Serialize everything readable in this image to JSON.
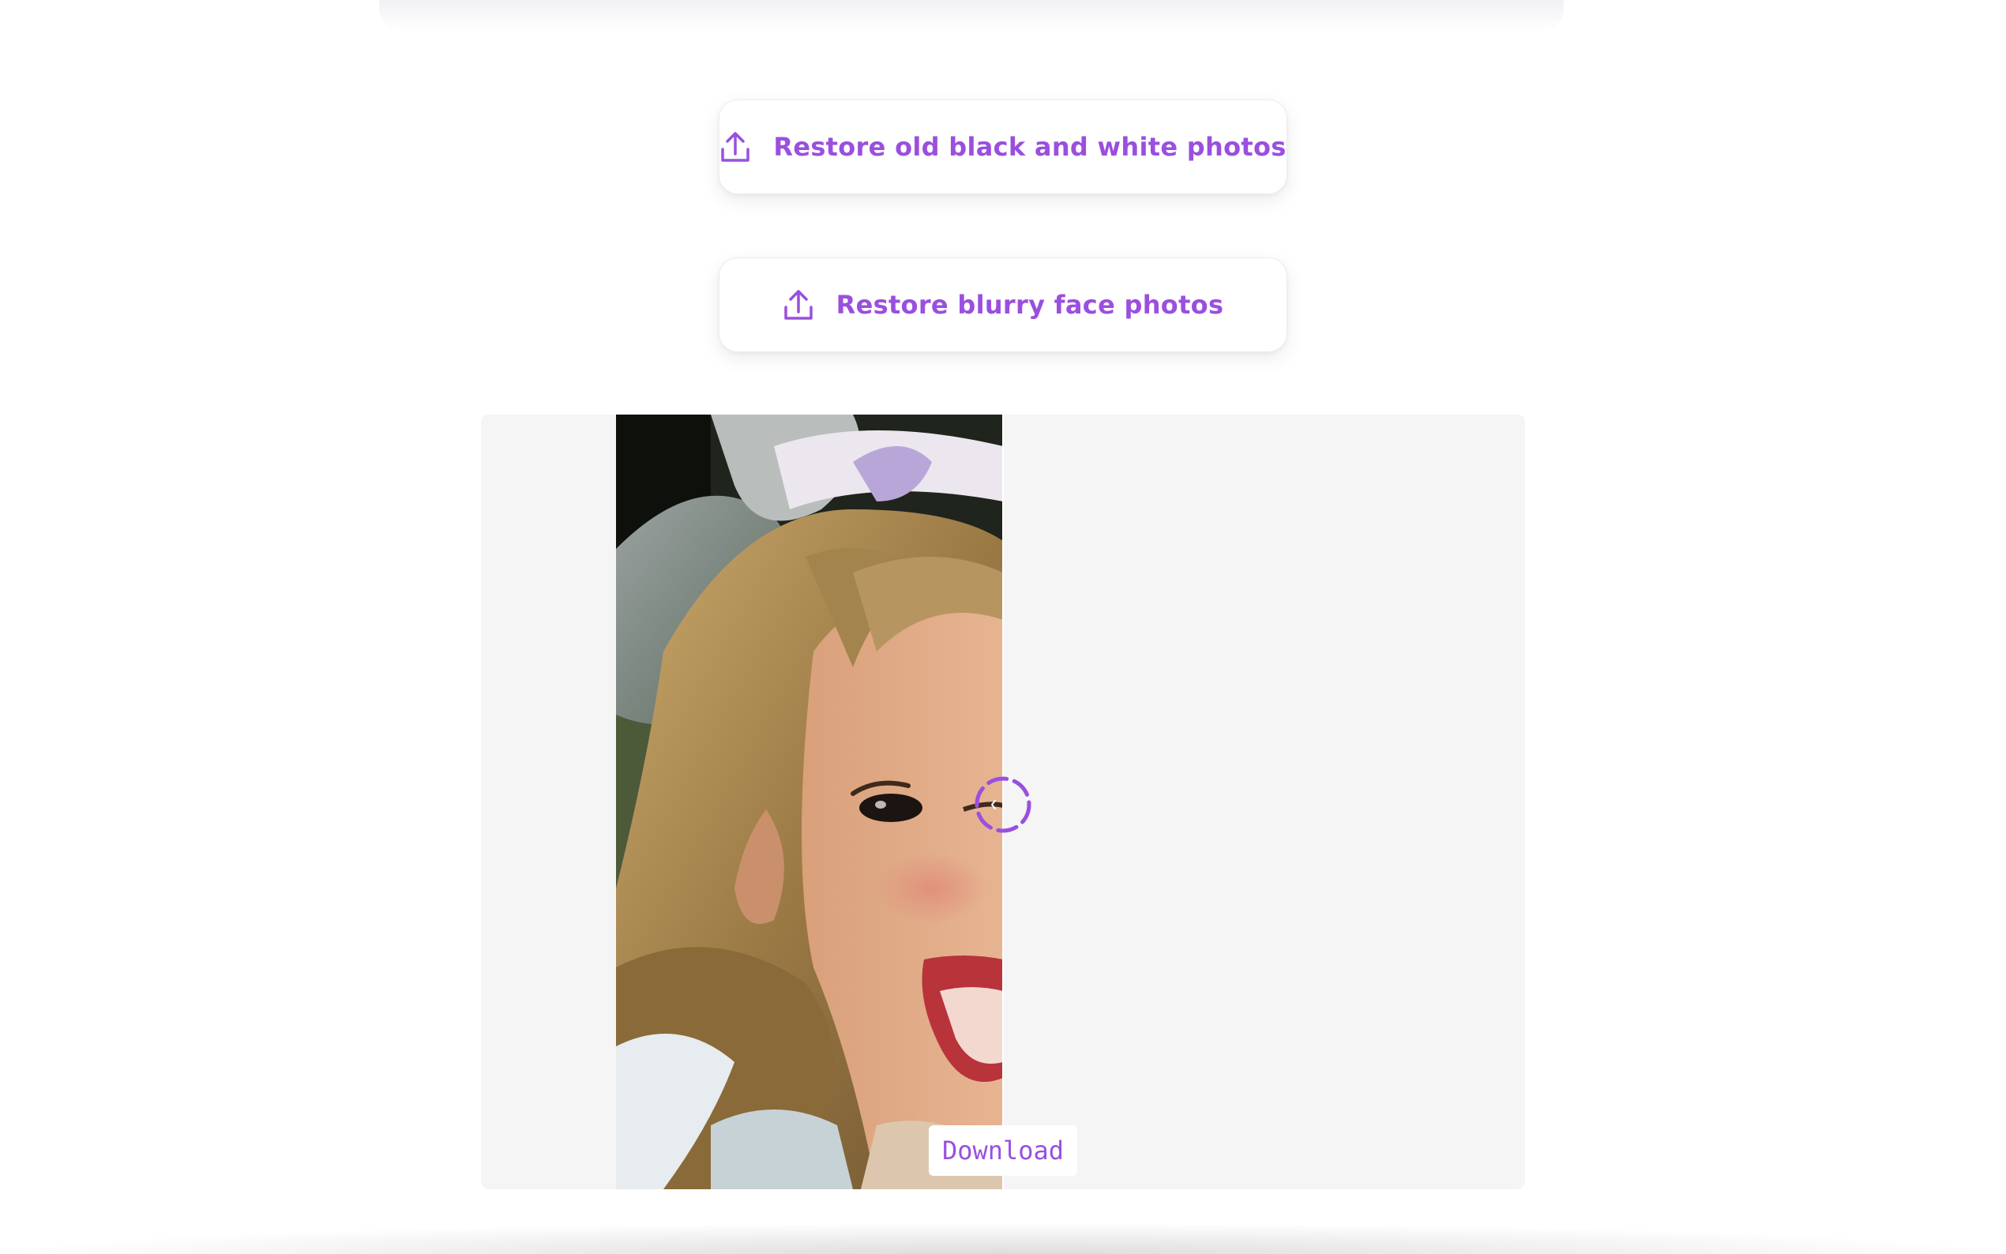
{
  "buttons": {
    "restore_bw": {
      "label": "Restore old black and white photos",
      "icon": "upload-icon"
    },
    "restore_face": {
      "label": "Restore blurry face photos",
      "icon": "upload-icon"
    }
  },
  "viewer": {
    "download_label": "Download",
    "slider_icon": "chevron-left-icon",
    "image_alt": "Photo of a smiling young girl with a large bow in her blonde hair"
  },
  "colors": {
    "accent": "#9a4fde",
    "viewer_background": "#f5f5f5"
  }
}
